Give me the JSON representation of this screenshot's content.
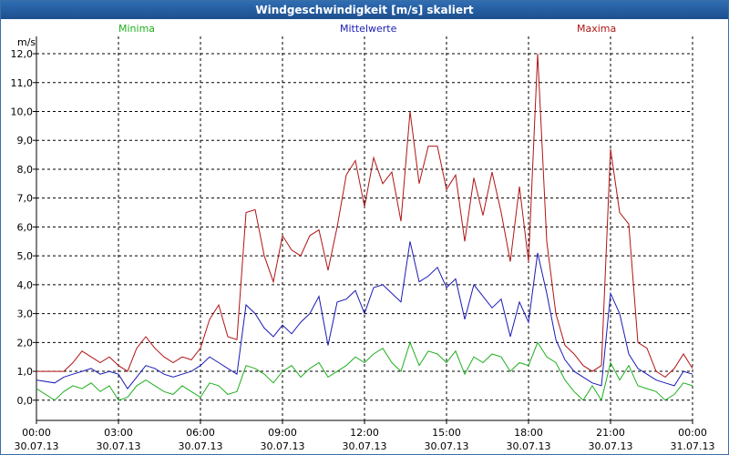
{
  "title": "Windgeschwindigkeit [m/s] skaliert",
  "legend": {
    "min": "Minima",
    "mean": "Mittelwerte",
    "max": "Maxima"
  },
  "unit": "m/s",
  "colors": {
    "min": "#1faf1f",
    "mean": "#1a1ab5",
    "max": "#b01414",
    "title_bg": "#1d4f8f"
  },
  "chart_data": {
    "type": "line",
    "title": "Windgeschwindigkeit [m/s] skaliert",
    "ylabel": "m/s",
    "ylim": [
      -0.7,
      12.6
    ],
    "xlim": [
      "30.07.13 00:00",
      "31.07.13 00:00"
    ],
    "grid": true,
    "legend_position": "top",
    "y_ticks": [
      "0,0",
      "1,0",
      "2,0",
      "3,0",
      "4,0",
      "5,0",
      "6,0",
      "7,0",
      "8,0",
      "9,0",
      "10,0",
      "11,0",
      "12,0"
    ],
    "x_ticks": [
      {
        "time": "00:00",
        "date": "30.07.13"
      },
      {
        "time": "03:00",
        "date": "30.07.13"
      },
      {
        "time": "06:00",
        "date": "30.07.13"
      },
      {
        "time": "09:00",
        "date": "30.07.13"
      },
      {
        "time": "12:00",
        "date": "30.07.13"
      },
      {
        "time": "15:00",
        "date": "30.07.13"
      },
      {
        "time": "18:00",
        "date": "30.07.13"
      },
      {
        "time": "21:00",
        "date": "30.07.13"
      },
      {
        "time": "00:00",
        "date": "31.07.13"
      }
    ],
    "series": [
      {
        "name": "Maxima",
        "color": "#b01414",
        "x": [
          "00:00",
          "00:40",
          "01:00",
          "01:20",
          "01:40",
          "02:00",
          "02:20",
          "02:40",
          "03:00",
          "03:20",
          "03:40",
          "04:00",
          "04:20",
          "04:40",
          "05:00",
          "05:20",
          "05:40",
          "06:00",
          "06:20",
          "06:40",
          "07:00",
          "07:20",
          "07:40",
          "08:00",
          "08:20",
          "08:40",
          "09:00",
          "09:20",
          "09:40",
          "10:00",
          "10:20",
          "10:40",
          "11:00",
          "11:20",
          "11:40",
          "12:00",
          "12:20",
          "12:40",
          "13:00",
          "13:20",
          "13:40",
          "14:00",
          "14:20",
          "14:40",
          "15:00",
          "15:20",
          "15:40",
          "16:00",
          "16:20",
          "16:40",
          "17:00",
          "17:20",
          "17:40",
          "18:00",
          "18:20",
          "18:40",
          "19:00",
          "19:20",
          "19:40",
          "20:00",
          "20:20",
          "20:40",
          "21:00",
          "21:20",
          "21:40",
          "22:00",
          "22:20",
          "22:40",
          "23:00",
          "23:20",
          "23:40",
          "24:00"
        ],
        "values": [
          1.0,
          1.0,
          1.0,
          1.3,
          1.7,
          1.5,
          1.3,
          1.5,
          1.2,
          1.0,
          1.8,
          2.2,
          1.8,
          1.5,
          1.3,
          1.5,
          1.4,
          1.8,
          2.8,
          3.3,
          2.2,
          2.1,
          6.5,
          6.6,
          5.0,
          4.1,
          5.7,
          5.2,
          5.0,
          5.7,
          5.9,
          4.5,
          6.0,
          7.8,
          8.3,
          6.7,
          8.4,
          7.5,
          7.9,
          6.2,
          10.0,
          7.5,
          8.8,
          8.8,
          7.3,
          7.8,
          5.5,
          7.7,
          6.4,
          7.9,
          6.5,
          4.8,
          7.4,
          4.8,
          12.0,
          5.5,
          3.0,
          1.9,
          1.6,
          1.2,
          1.0,
          1.2,
          8.7,
          6.5,
          6.1,
          2.0,
          1.8,
          1.0,
          0.8,
          1.1,
          1.6,
          1.1
        ]
      },
      {
        "name": "Mittelwerte",
        "color": "#1a1ab5",
        "x": [
          "00:00",
          "00:40",
          "01:00",
          "01:20",
          "01:40",
          "02:00",
          "02:20",
          "02:40",
          "03:00",
          "03:20",
          "03:40",
          "04:00",
          "04:20",
          "04:40",
          "05:00",
          "05:20",
          "05:40",
          "06:00",
          "06:20",
          "06:40",
          "07:00",
          "07:20",
          "07:40",
          "08:00",
          "08:20",
          "08:40",
          "09:00",
          "09:20",
          "09:40",
          "10:00",
          "10:20",
          "10:40",
          "11:00",
          "11:20",
          "11:40",
          "12:00",
          "12:20",
          "12:40",
          "13:00",
          "13:20",
          "13:40",
          "14:00",
          "14:20",
          "14:40",
          "15:00",
          "15:20",
          "15:40",
          "16:00",
          "16:20",
          "16:40",
          "17:00",
          "17:20",
          "17:40",
          "18:00",
          "18:20",
          "18:40",
          "19:00",
          "19:20",
          "19:40",
          "20:00",
          "20:20",
          "20:40",
          "21:00",
          "21:20",
          "21:40",
          "22:00",
          "22:20",
          "22:40",
          "23:00",
          "23:20",
          "23:40",
          "24:00"
        ],
        "values": [
          0.7,
          0.6,
          0.8,
          0.9,
          1.0,
          1.1,
          0.9,
          1.0,
          0.9,
          0.4,
          0.8,
          1.2,
          1.1,
          0.9,
          0.8,
          0.9,
          1.0,
          1.2,
          1.5,
          1.3,
          1.1,
          0.9,
          3.3,
          3.0,
          2.5,
          2.2,
          2.6,
          2.3,
          2.7,
          3.0,
          3.6,
          1.9,
          3.4,
          3.5,
          3.8,
          3.0,
          3.9,
          4.0,
          3.7,
          3.4,
          5.5,
          4.1,
          4.3,
          4.6,
          3.9,
          4.2,
          2.8,
          4.0,
          3.6,
          3.2,
          3.5,
          2.2,
          3.4,
          2.7,
          5.1,
          3.7,
          2.1,
          1.4,
          1.0,
          0.8,
          0.6,
          0.5,
          3.7,
          3.0,
          1.6,
          1.1,
          0.9,
          0.7,
          0.6,
          0.5,
          1.0,
          0.9
        ]
      },
      {
        "name": "Minima",
        "color": "#1faf1f",
        "x": [
          "00:00",
          "00:40",
          "01:00",
          "01:20",
          "01:40",
          "02:00",
          "02:20",
          "02:40",
          "03:00",
          "03:20",
          "03:40",
          "04:00",
          "04:20",
          "04:40",
          "05:00",
          "05:20",
          "05:40",
          "06:00",
          "06:20",
          "06:40",
          "07:00",
          "07:20",
          "07:40",
          "08:00",
          "08:20",
          "08:40",
          "09:00",
          "09:20",
          "09:40",
          "10:00",
          "10:20",
          "10:40",
          "11:00",
          "11:20",
          "11:40",
          "12:00",
          "12:20",
          "12:40",
          "13:00",
          "13:20",
          "13:40",
          "14:00",
          "14:20",
          "14:40",
          "15:00",
          "15:20",
          "15:40",
          "16:00",
          "16:20",
          "16:40",
          "17:00",
          "17:20",
          "17:40",
          "18:00",
          "18:20",
          "18:40",
          "19:00",
          "19:20",
          "19:40",
          "20:00",
          "20:20",
          "20:40",
          "21:00",
          "21:20",
          "21:40",
          "22:00",
          "22:20",
          "22:40",
          "23:00",
          "23:20",
          "23:40",
          "24:00"
        ],
        "values": [
          0.4,
          0.0,
          0.3,
          0.5,
          0.4,
          0.6,
          0.3,
          0.5,
          0.0,
          0.1,
          0.5,
          0.7,
          0.5,
          0.3,
          0.2,
          0.5,
          0.3,
          0.1,
          0.6,
          0.5,
          0.2,
          0.3,
          1.2,
          1.1,
          0.9,
          0.6,
          1.0,
          1.2,
          0.8,
          1.1,
          1.3,
          0.8,
          1.0,
          1.2,
          1.5,
          1.3,
          1.6,
          1.8,
          1.3,
          1.0,
          2.0,
          1.2,
          1.7,
          1.6,
          1.3,
          1.7,
          0.9,
          1.5,
          1.3,
          1.6,
          1.5,
          1.0,
          1.3,
          1.2,
          2.0,
          1.5,
          1.3,
          0.7,
          0.3,
          0.0,
          0.5,
          0.0,
          1.3,
          0.7,
          1.2,
          0.5,
          0.4,
          0.3,
          0.0,
          0.2,
          0.6,
          0.5
        ]
      }
    ]
  }
}
